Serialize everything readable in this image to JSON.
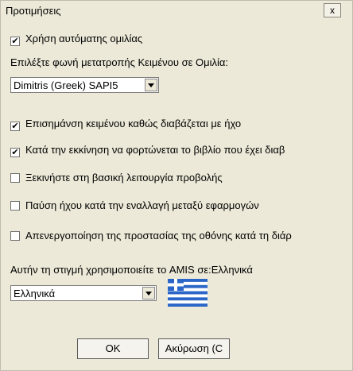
{
  "window": {
    "title": "Προτιμήσεις",
    "close_symbol": "x"
  },
  "speech": {
    "use_speech_checkbox": {
      "checked": true,
      "label": "Χρήση αυτόματης ομιλίας"
    },
    "voice_prompt": "Επιλέξτε φωνή μετατροπής Κειμένου σε Ομιλία:",
    "voice_select": {
      "value": "Dimitris (Greek) SAPI5"
    }
  },
  "options": [
    {
      "checked": true,
      "label": "Επισημάνση κειμένου καθώς διαβάζεται με ήχο"
    },
    {
      "checked": true,
      "label": "Κατά την εκκίνηση να φορτώνεται το βιβλίο που έχει διαβ"
    },
    {
      "checked": false,
      "label": "Ξεκινήστε στη βασική λειτουργία προβολής"
    },
    {
      "checked": false,
      "label": "Παύση ήχου κατά την εναλλαγή μεταξύ εφαρμογών"
    },
    {
      "checked": false,
      "label": "Απενεργοποίηση της προστασίας της οθόνης κατά τη διάρ"
    }
  ],
  "language": {
    "prompt": "Αυτήν τη στιγμή χρησιμοποιείτε το AMIS σε:Ελληνικά",
    "select": {
      "value": "Ελληνικά"
    },
    "flag_icon": "greek-flag-icon"
  },
  "buttons": {
    "ok": "OK",
    "cancel": "Ακύρωση (C"
  },
  "check_mark": "✔",
  "colors": {
    "background": "#ece9d8",
    "flag_blue": "#2a66c8"
  }
}
